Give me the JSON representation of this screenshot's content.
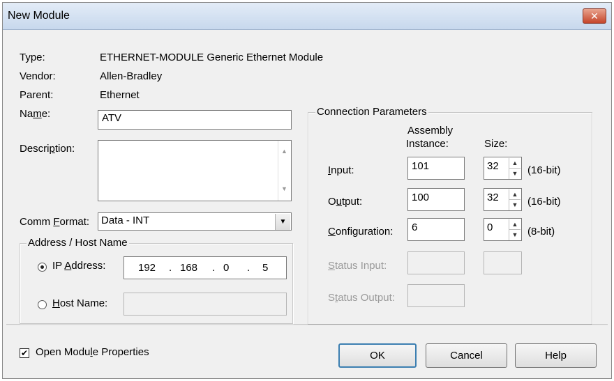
{
  "window": {
    "title": "New Module",
    "close_glyph": "✕"
  },
  "info": {
    "type_label": "Type:",
    "type_value": "ETHERNET-MODULE Generic Ethernet Module",
    "vendor_label": "Vendor:",
    "vendor_value": "Allen-Bradley",
    "parent_label": "Parent:",
    "parent_value": "Ethernet"
  },
  "name": {
    "label_pre": "Na",
    "label_mn": "m",
    "label_post": "e:",
    "value": "ATV"
  },
  "description": {
    "label_pre": "Descri",
    "label_mn": "p",
    "label_post": "tion:",
    "value": ""
  },
  "comm_format": {
    "label_pre": "Comm ",
    "label_mn": "F",
    "label_post": "ormat:",
    "value": "Data - INT"
  },
  "address": {
    "legend": "Address / Host Name",
    "ip_label_pre": "IP ",
    "ip_label_mn": "A",
    "ip_label_post": "ddress:",
    "ip_octets": [
      "192",
      "168",
      "0",
      "5"
    ],
    "ip_selected": true,
    "host_label_pre": "",
    "host_label_mn": "H",
    "host_label_post": "ost Name:",
    "host_value": ""
  },
  "connection": {
    "legend": "Connection Parameters",
    "col_assembly_1": "Assembly",
    "col_assembly_2": "Instance:",
    "col_size": "Size:",
    "input": {
      "label_mn": "I",
      "label_post": "nput:",
      "assembly": "101",
      "size": "32",
      "unit": "(16-bit)"
    },
    "output": {
      "label_pre": "O",
      "label_mn": "u",
      "label_post": "tput:",
      "assembly": "100",
      "size": "32",
      "unit": "(16-bit)"
    },
    "configuration": {
      "label_mn": "C",
      "label_post": "onfiguration:",
      "assembly": "6",
      "size": "0",
      "unit": "(8-bit)"
    },
    "status_input": {
      "label_mn": "S",
      "label_post": "tatus Input:"
    },
    "status_output": {
      "label_pre": "S",
      "label_mn": "t",
      "label_post": "atus Output:"
    }
  },
  "footer": {
    "open_props_pre": "Open Modu",
    "open_props_mn": "l",
    "open_props_post": "e Properties",
    "open_props_checked": true,
    "ok": "OK",
    "cancel": "Cancel",
    "help": "Help"
  }
}
